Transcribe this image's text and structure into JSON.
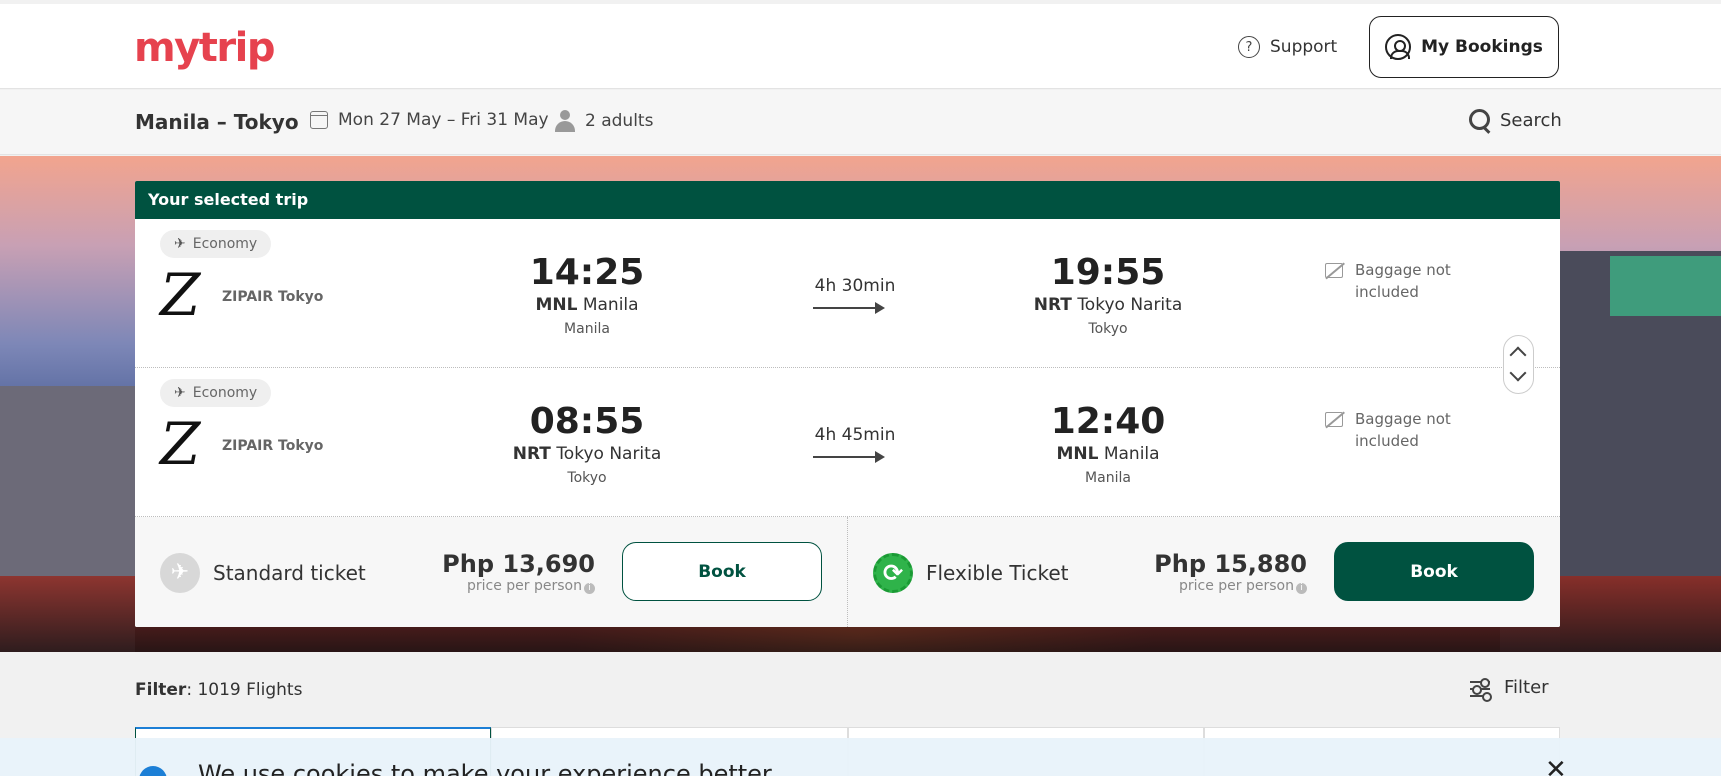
{
  "header": {
    "logo": "mytrip",
    "support_label": "Support",
    "support_icon": "?",
    "bookings_label": "My Bookings"
  },
  "search": {
    "route": "Manila – Tokyo",
    "dates": "Mon 27 May – Fri 31 May",
    "passengers": "2 adults",
    "search_label": "Search"
  },
  "trip": {
    "title": "Your selected trip",
    "legs": [
      {
        "cabin": "Economy",
        "airline_logo": "Z",
        "airline": "ZIPAIR Tokyo",
        "dep_time": "14:25",
        "dep_code": "MNL",
        "dep_airport": "Manila",
        "dep_city": "Manila",
        "duration": "4h 30min",
        "arr_time": "19:55",
        "arr_code": "NRT",
        "arr_airport": "Tokyo Narita",
        "arr_city": "Tokyo",
        "baggage": "Baggage not included"
      },
      {
        "cabin": "Economy",
        "airline_logo": "Z",
        "airline": "ZIPAIR Tokyo",
        "dep_time": "08:55",
        "dep_code": "NRT",
        "dep_airport": "Tokyo Narita",
        "dep_city": "Tokyo",
        "duration": "4h 45min",
        "arr_time": "12:40",
        "arr_code": "MNL",
        "arr_airport": "Manila",
        "arr_city": "Manila",
        "baggage": "Baggage not included"
      }
    ],
    "tickets": [
      {
        "name": "Standard ticket",
        "price": "Php 13,690",
        "price_note": "price per person",
        "book_label": "Book",
        "icon": "✈"
      },
      {
        "name": "Flexible Ticket",
        "price": "Php 15,880",
        "price_note": "price per person",
        "book_label": "Book",
        "icon": "⟳"
      }
    ]
  },
  "filter": {
    "label": "Filter",
    "count": ": 1019 Flights",
    "button_label": "Filter"
  },
  "cookie": {
    "text": "We use cookies to make your experience better",
    "close": "✕"
  },
  "colors": {
    "brand": "#e6424e",
    "accent": "#005240",
    "info": "#1c7fd6"
  }
}
